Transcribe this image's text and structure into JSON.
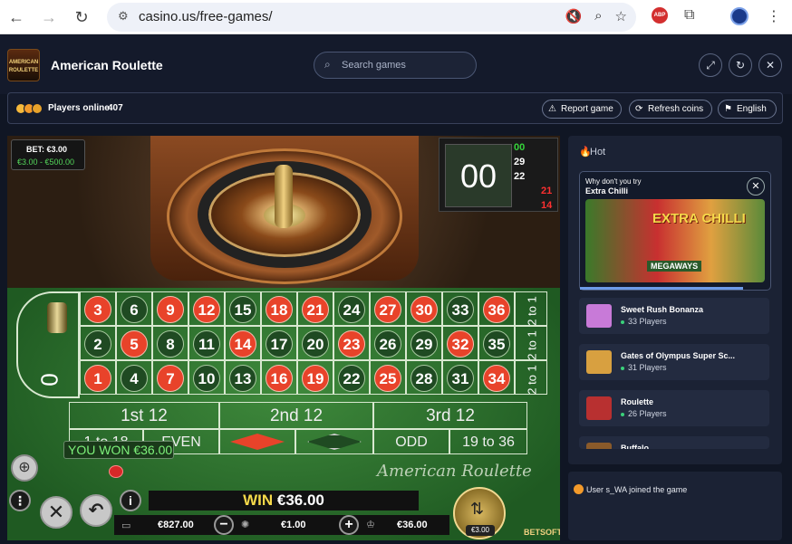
{
  "browser": {
    "url": "casino.us/free-games/",
    "ext_label": "ABP"
  },
  "header": {
    "logo_text": "AMERICAN ROULETTE",
    "title": "American Roulette",
    "search_placeholder": "Search games"
  },
  "infobar": {
    "players_label": "Players online",
    "players_count": "407",
    "report_label": "Report game",
    "refresh_label": "Refresh coins",
    "language_label": "English"
  },
  "game": {
    "bet_label": "BET: €3.00",
    "bet_range": "€3.00 - €500.00",
    "last_result": "00",
    "history": [
      {
        "value": "00",
        "color": "#35d43a"
      },
      {
        "value": "29",
        "color": "#ffffff"
      },
      {
        "value": "22",
        "color": "#ffffff"
      },
      {
        "value": "21",
        "color": "#ff3030"
      },
      {
        "value": "14",
        "color": "#ff3030"
      }
    ],
    "zero_label": "0",
    "rows": [
      [
        {
          "n": "3",
          "c": "red"
        },
        {
          "n": "6",
          "c": "black"
        },
        {
          "n": "9",
          "c": "red"
        },
        {
          "n": "12",
          "c": "red"
        },
        {
          "n": "15",
          "c": "black"
        },
        {
          "n": "18",
          "c": "red"
        },
        {
          "n": "21",
          "c": "red"
        },
        {
          "n": "24",
          "c": "black"
        },
        {
          "n": "27",
          "c": "red"
        },
        {
          "n": "30",
          "c": "red"
        },
        {
          "n": "33",
          "c": "black"
        },
        {
          "n": "36",
          "c": "red"
        }
      ],
      [
        {
          "n": "2",
          "c": "black"
        },
        {
          "n": "5",
          "c": "red"
        },
        {
          "n": "8",
          "c": "black"
        },
        {
          "n": "11",
          "c": "black"
        },
        {
          "n": "14",
          "c": "red"
        },
        {
          "n": "17",
          "c": "black"
        },
        {
          "n": "20",
          "c": "black"
        },
        {
          "n": "23",
          "c": "red"
        },
        {
          "n": "26",
          "c": "black"
        },
        {
          "n": "29",
          "c": "black"
        },
        {
          "n": "32",
          "c": "red"
        },
        {
          "n": "35",
          "c": "black"
        }
      ],
      [
        {
          "n": "1",
          "c": "red"
        },
        {
          "n": "4",
          "c": "black"
        },
        {
          "n": "7",
          "c": "red"
        },
        {
          "n": "10",
          "c": "black"
        },
        {
          "n": "13",
          "c": "black"
        },
        {
          "n": "16",
          "c": "red"
        },
        {
          "n": "19",
          "c": "red"
        },
        {
          "n": "22",
          "c": "black"
        },
        {
          "n": "25",
          "c": "red"
        },
        {
          "n": "28",
          "c": "black"
        },
        {
          "n": "31",
          "c": "black"
        },
        {
          "n": "34",
          "c": "red"
        }
      ]
    ],
    "column_bet_label": "2 to 1",
    "dozens": [
      "1st 12",
      "2nd 12",
      "3rd 12"
    ],
    "outside": {
      "low": "1 to 18",
      "even": "EVEN",
      "odd": "ODD",
      "high": "19 to 36"
    },
    "won_text": "YOU WON €36.00",
    "table_script": "American Roulette",
    "win_label": "WIN",
    "win_amount": "€36.00",
    "balance": "€827.00",
    "chip_value": "€1.00",
    "total_bet": "€36.00",
    "spin_amount": "€3.00",
    "provider": "BETSOFT"
  },
  "sidebar": {
    "hot_label": "Hot",
    "feature_question": "Why don't you try",
    "feature_name": "Extra Chilli",
    "feature_image_text": "EXTRA CHILLI",
    "feature_image_sub": "MEGAWAYS",
    "games": [
      {
        "name": "Sweet Rush Bonanza",
        "players": "33 Players",
        "color": "#c87ad8"
      },
      {
        "name": "Gates of Olympus Super Sc...",
        "players": "31 Players",
        "color": "#d8a040"
      },
      {
        "name": "Roulette",
        "players": "26 Players",
        "color": "#b83030"
      },
      {
        "name": "Buffalo",
        "players": "",
        "color": "#8a5a2a"
      }
    ]
  },
  "chat": {
    "message": "User s_WA joined the game"
  }
}
